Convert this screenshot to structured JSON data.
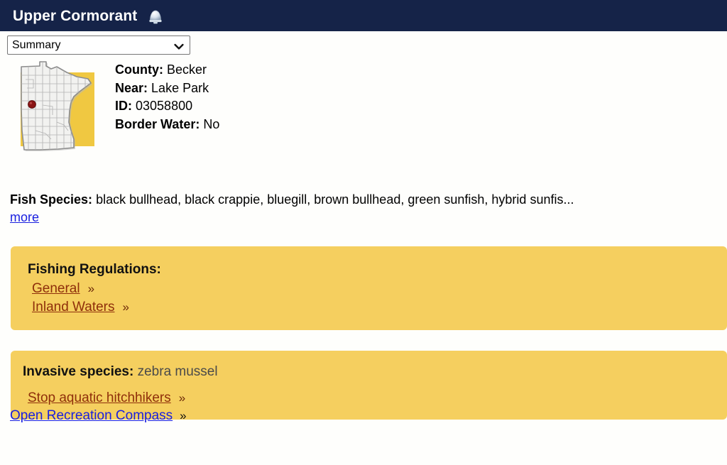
{
  "header": {
    "title": "Upper Cormorant",
    "icon": "lake-dome-icon",
    "background_color": "#152348",
    "text_color": "#ffffff"
  },
  "view_selector": {
    "name": "view-select",
    "selected": "Summary",
    "options": [
      "Summary"
    ]
  },
  "map": {
    "alt": "Minnesota county map with lake location marker",
    "background_color": "#f0c841",
    "state_fill": "#f2f2f0",
    "marker_color": "#a01818",
    "marker_label": "lake-location-marker"
  },
  "facts": [
    {
      "label": "County:",
      "value": "Becker"
    },
    {
      "label": "Near:",
      "value": "Lake Park"
    },
    {
      "label": "ID:",
      "value": "03058800"
    },
    {
      "label": "Border Water:",
      "value": "No"
    }
  ],
  "fish": {
    "label": "Fish Species:",
    "value": "black bullhead, black crappie, bluegill, brown bullhead, green sunfish, hybrid sunfis...",
    "more_label": "more"
  },
  "regulations": {
    "title": "Fishing Regulations:",
    "panel_color": "#f5cf5f",
    "link_color": "#8f2f0a",
    "links": [
      {
        "label": "General",
        "chevron": "»"
      },
      {
        "label": "Inland Waters",
        "chevron": "»"
      }
    ]
  },
  "invasive": {
    "label": "Invasive species:",
    "value": "zebra mussel",
    "panel_color": "#f5cf5f",
    "link": {
      "label": "Stop aquatic hitchhikers",
      "chevron": "»"
    }
  },
  "bottom": {
    "link_label": "Open Recreation Compass",
    "chevron": "»",
    "link_color": "#1a20e0"
  }
}
